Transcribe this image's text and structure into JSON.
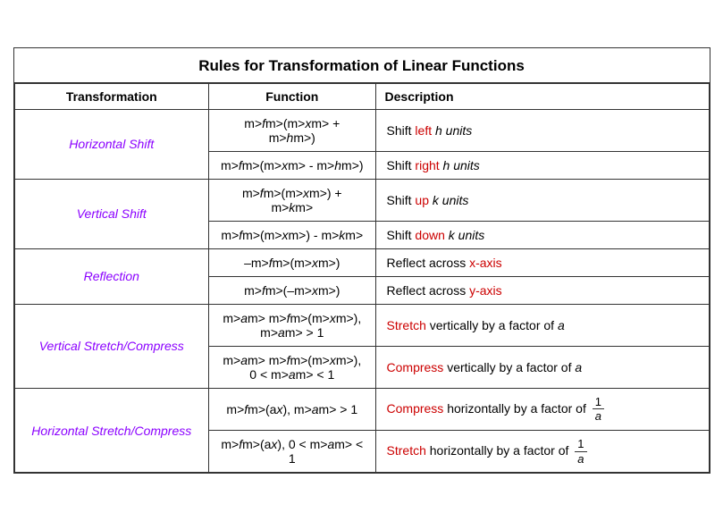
{
  "title": "Rules for Transformation of Linear Functions",
  "headers": {
    "transformation": "Transformation",
    "function": "Function",
    "description": "Description"
  },
  "rows": [
    {
      "transform": "Horizontal Shift",
      "function": "f(x + h)",
      "desc_parts": [
        {
          "text": "Shift ",
          "color": "black"
        },
        {
          "text": "left",
          "color": "red"
        },
        {
          "text": " h units",
          "color": "black",
          "italic": true
        }
      ]
    },
    {
      "transform": "",
      "function": "f(x  - h)",
      "desc_parts": [
        {
          "text": "Shift ",
          "color": "black"
        },
        {
          "text": "right",
          "color": "red"
        },
        {
          "text": " h units",
          "color": "black",
          "italic": true
        }
      ]
    },
    {
      "transform": "Vertical Shift",
      "function": "f(x) + k",
      "desc_parts": [
        {
          "text": "Shift ",
          "color": "black"
        },
        {
          "text": "up",
          "color": "red"
        },
        {
          "text": " k units",
          "color": "black",
          "italic": true
        }
      ]
    },
    {
      "transform": "",
      "function": "f(x) - k",
      "desc_parts": [
        {
          "text": "Shift ",
          "color": "black"
        },
        {
          "text": "down",
          "color": "red"
        },
        {
          "text": " k units",
          "color": "black",
          "italic": true
        }
      ]
    },
    {
      "transform": "Reflection",
      "function": "–f(x)",
      "desc_parts": [
        {
          "text": "Reflect across ",
          "color": "black"
        },
        {
          "text": "x-axis",
          "color": "red"
        }
      ]
    },
    {
      "transform": "",
      "function": "f(–x)",
      "desc_parts": [
        {
          "text": "Reflect across ",
          "color": "black"
        },
        {
          "text": "y-axis",
          "color": "red"
        }
      ]
    },
    {
      "transform": "Vertical Stretch/Compress",
      "function": "a f(x), a > 1",
      "desc_parts": [
        {
          "text": "Stretch",
          "color": "red-orange"
        },
        {
          "text": " vertically by a factor of ",
          "color": "black"
        },
        {
          "text": "a",
          "color": "black",
          "italic": true
        }
      ]
    },
    {
      "transform": "",
      "function": "a f(x), 0 < a < 1",
      "desc_parts": [
        {
          "text": "Compress",
          "color": "red-orange"
        },
        {
          "text": " vertically by a factor of ",
          "color": "black"
        },
        {
          "text": "a",
          "color": "black",
          "italic": true
        }
      ]
    },
    {
      "transform": "Horizontal Stretch/Compress",
      "function": "f(ax), a > 1",
      "desc_type": "fraction",
      "desc_parts": [
        {
          "text": "Compress",
          "color": "red-orange"
        },
        {
          "text": " horizontally by a factor of ",
          "color": "black"
        }
      ],
      "fraction": {
        "num": "1",
        "den": "a"
      }
    },
    {
      "transform": "",
      "function": "f(ax), 0 < a < 1",
      "desc_type": "fraction",
      "desc_parts": [
        {
          "text": "Stretch",
          "color": "red-orange"
        },
        {
          "text": " horizontally by a factor of ",
          "color": "black"
        }
      ],
      "fraction": {
        "num": "1",
        "den": "a"
      }
    }
  ]
}
